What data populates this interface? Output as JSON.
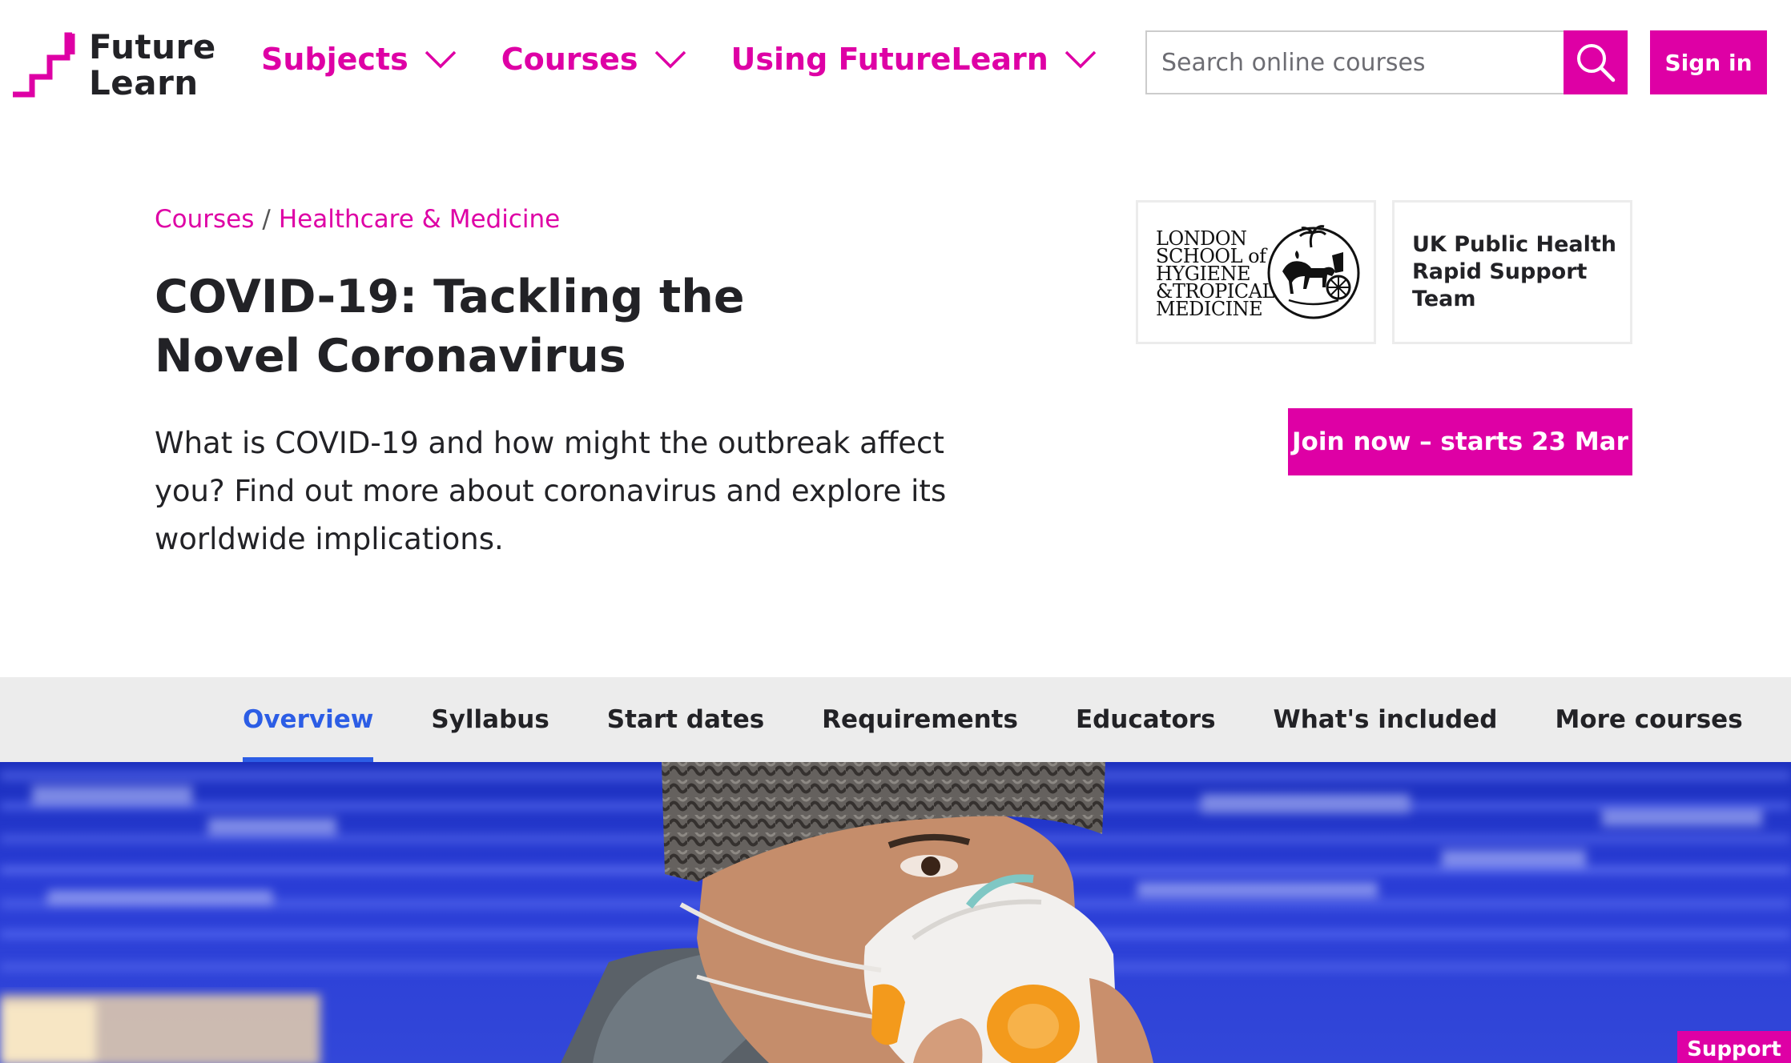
{
  "brand": {
    "logo_line1": "Future",
    "logo_line2": "Learn",
    "accent_color": "#de00a5",
    "tab_active_color": "#2c5de5"
  },
  "nav": {
    "items": [
      {
        "label": "Subjects",
        "icon": "chevron-down-icon"
      },
      {
        "label": "Courses",
        "icon": "chevron-down-icon"
      },
      {
        "label": "Using FutureLearn",
        "icon": "chevron-down-icon"
      }
    ]
  },
  "search": {
    "placeholder": "Search online courses",
    "button_icon": "search-icon"
  },
  "header": {
    "signin_label": "Sign in"
  },
  "breadcrumb": {
    "items": [
      "Courses",
      "Healthcare & Medicine"
    ],
    "separator": "/"
  },
  "course": {
    "title": "COVID-19: Tackling the Novel Coronavirus",
    "description": "What is COVID-19 and how might the outbreak affect you? Find out more about coronavirus and explore its worldwide implications.",
    "join_label": "Join now – starts 23 Mar"
  },
  "partners": [
    {
      "name": "LONDON SCHOOL of HYGIENE &TROPICAL MEDICINE",
      "lines": [
        "LONDON",
        "SCHOOL of",
        "HYGIENE",
        "&TROPICAL",
        "MEDICINE"
      ],
      "seal_icon": "horse-chariot-seal-icon"
    },
    {
      "name": "UK Public Health Rapid Support Team",
      "lines": [
        "UK Public Health",
        "Rapid Support Team"
      ]
    }
  ],
  "tabs": [
    {
      "label": "Overview",
      "active": true
    },
    {
      "label": "Syllabus",
      "active": false
    },
    {
      "label": "Start dates",
      "active": false
    },
    {
      "label": "Requirements",
      "active": false
    },
    {
      "label": "Educators",
      "active": false
    },
    {
      "label": "What's included",
      "active": false
    },
    {
      "label": "More courses",
      "active": false
    }
  ],
  "support": {
    "label": "Support"
  }
}
